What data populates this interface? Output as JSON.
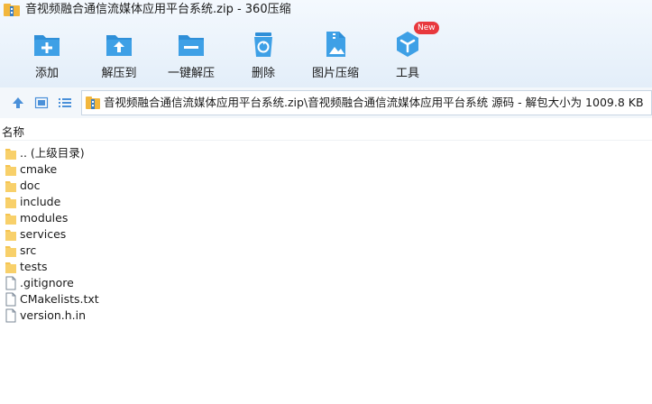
{
  "window": {
    "title": "音视频融合通信流媒体应用平台系统.zip - 360压缩"
  },
  "toolbar": {
    "items": [
      {
        "label": "添加",
        "icon": "add-icon"
      },
      {
        "label": "解压到",
        "icon": "extract-to-icon"
      },
      {
        "label": "一键解压",
        "icon": "one-click-extract-icon"
      },
      {
        "label": "删除",
        "icon": "delete-icon"
      },
      {
        "label": "图片压缩",
        "icon": "image-compress-icon"
      },
      {
        "label": "工具",
        "icon": "tools-icon",
        "badge": "New"
      }
    ]
  },
  "nav": {
    "address": "音视频融合通信流媒体应用平台系统.zip\\音视频融合通信流媒体应用平台系统 源码 - 解包大小为 1009.8 KB"
  },
  "list": {
    "column_name": "名称",
    "items": [
      {
        "name": ".. (上级目录)",
        "type": "folder"
      },
      {
        "name": "cmake",
        "type": "folder"
      },
      {
        "name": "doc",
        "type": "folder"
      },
      {
        "name": "include",
        "type": "folder"
      },
      {
        "name": "modules",
        "type": "folder"
      },
      {
        "name": "services",
        "type": "folder"
      },
      {
        "name": "src",
        "type": "folder"
      },
      {
        "name": "tests",
        "type": "folder"
      },
      {
        "name": ".gitignore",
        "type": "file"
      },
      {
        "name": "CMakelists.txt",
        "type": "file"
      },
      {
        "name": "version.h.in",
        "type": "file"
      }
    ]
  },
  "colors": {
    "accent": "#2f8fd8",
    "folder": "#f5c451",
    "badge": "#e8383d"
  }
}
